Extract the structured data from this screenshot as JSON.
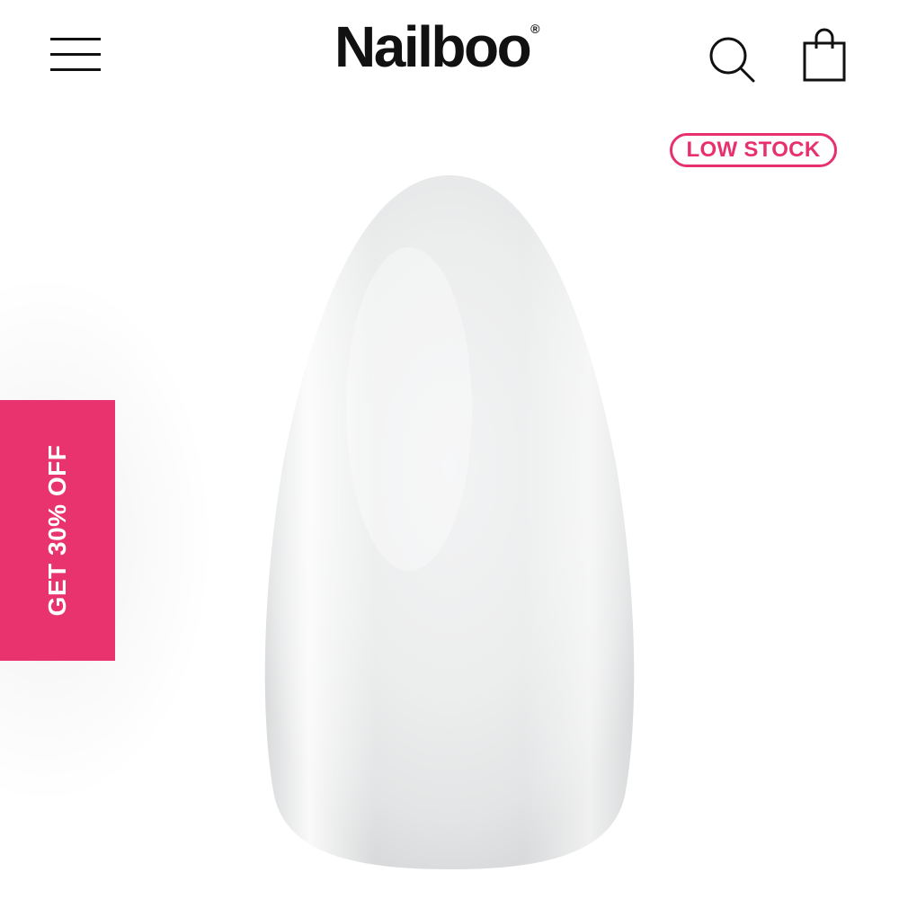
{
  "header": {
    "brand": "Nailboo",
    "brand_mark": "®",
    "menu_icon": "hamburger-menu-icon",
    "search_icon": "search-icon",
    "bag_icon": "shopping-bag-icon"
  },
  "product": {
    "stock_badge": "LOW STOCK",
    "image_alt_icon": "nail-tip-image"
  },
  "promo": {
    "label": "GET 30% OFF"
  },
  "colors": {
    "accent": "#e8306e",
    "promo_bg": "#e8336f",
    "text": "#111111",
    "background": "#ffffff"
  }
}
